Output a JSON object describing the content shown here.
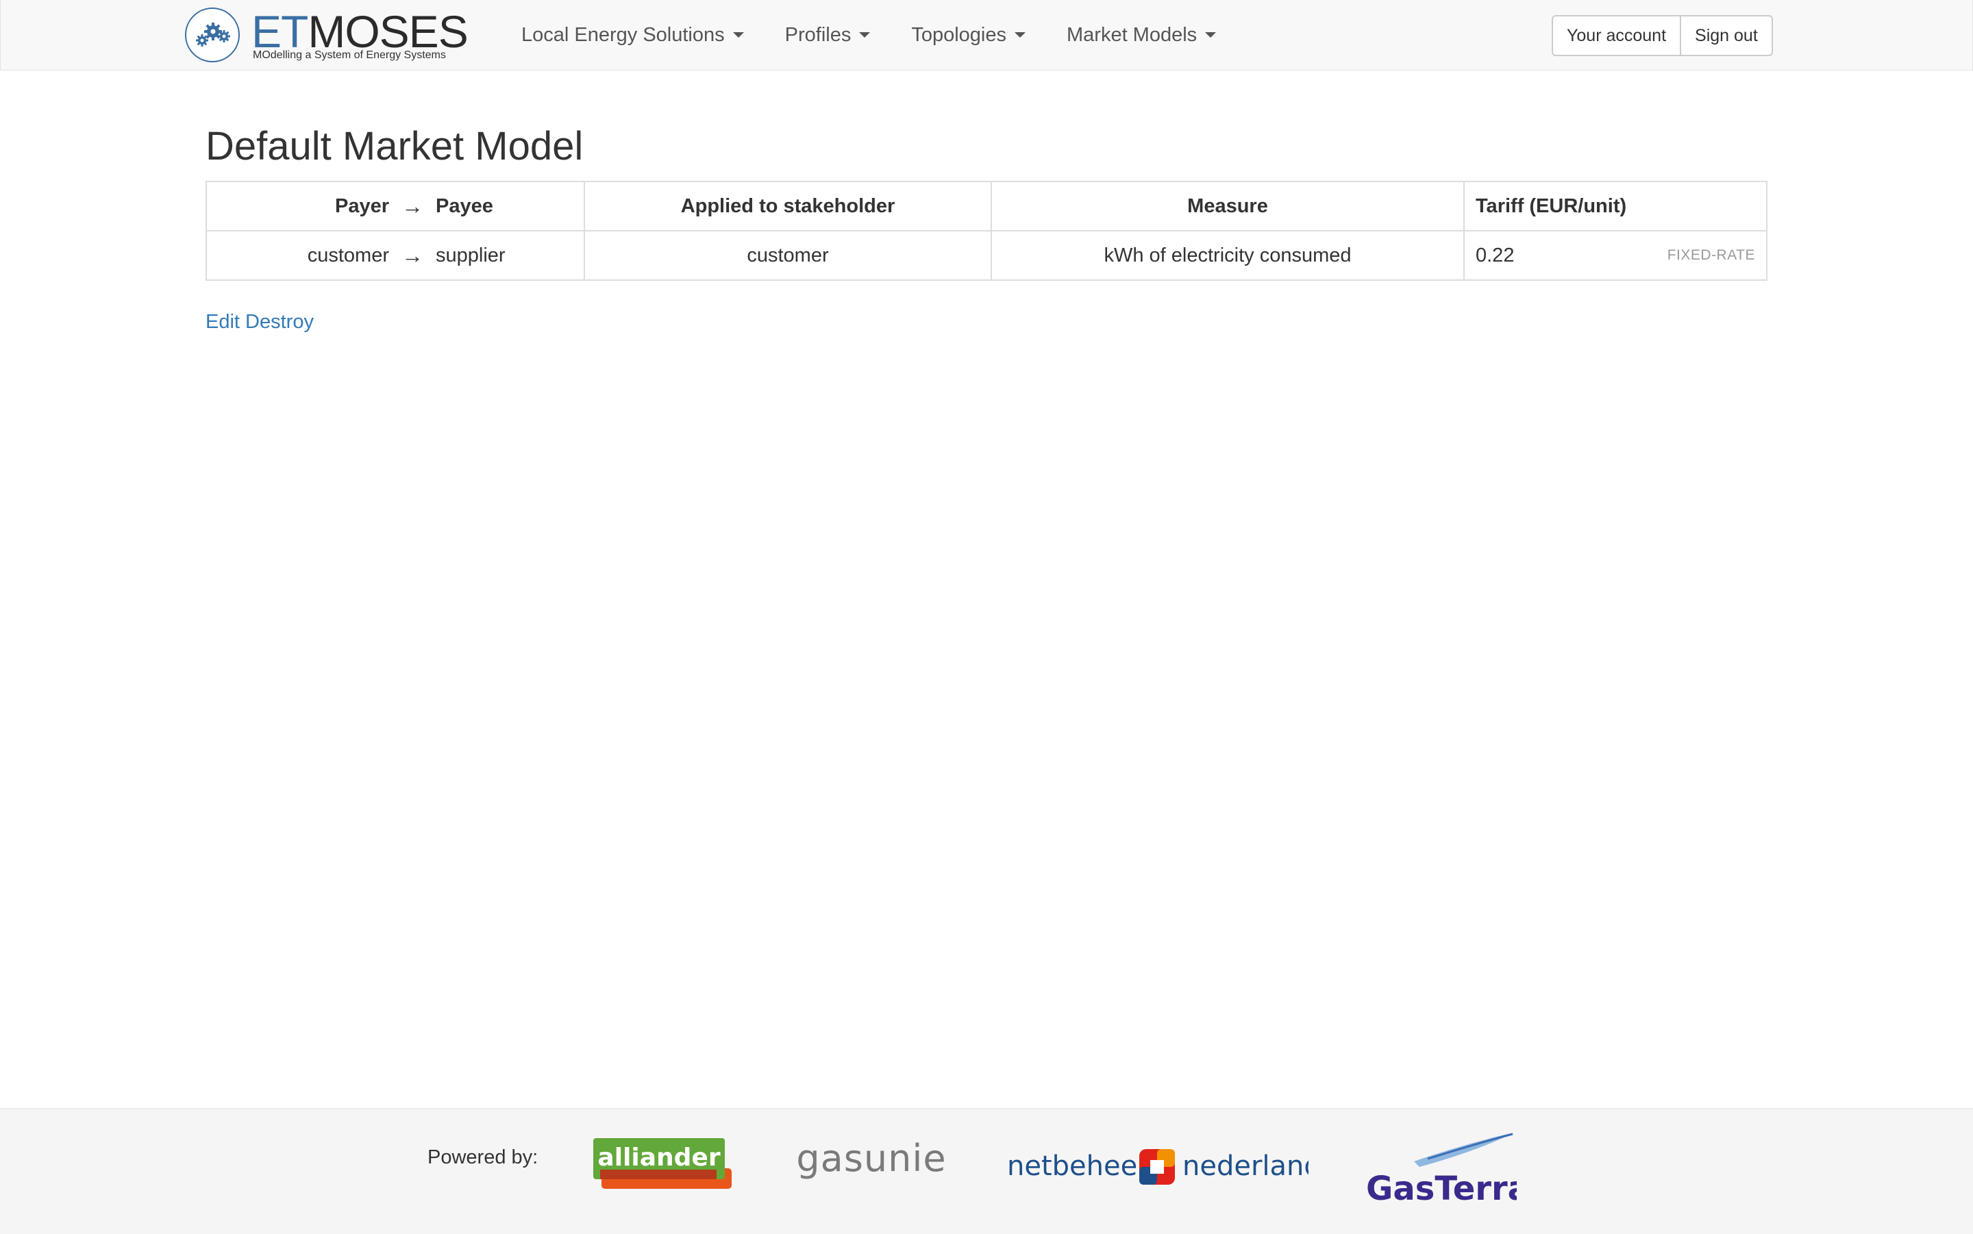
{
  "brand": {
    "name_prefix": "ET",
    "name_suffix": "MOSES",
    "subtitle": "MOdelling a System of Energy Systems",
    "accent_color": "#3a6fa3"
  },
  "nav": {
    "menus": [
      {
        "label": "Local Energy Solutions",
        "icon": "caret-down-icon"
      },
      {
        "label": "Profiles",
        "icon": "caret-down-icon"
      },
      {
        "label": "Topologies",
        "icon": "caret-down-icon"
      },
      {
        "label": "Market Models",
        "icon": "caret-down-icon"
      }
    ],
    "account_label": "Your account",
    "signout_label": "Sign out"
  },
  "page": {
    "title": "Default Market Model"
  },
  "table": {
    "headers": {
      "payer": "Payer",
      "arrow": "→",
      "payee": "Payee",
      "stakeholder": "Applied to stakeholder",
      "measure": "Measure",
      "tariff": "Tariff (EUR/unit)"
    },
    "rows": [
      {
        "payer": "customer",
        "arrow": "→",
        "payee": "supplier",
        "stakeholder": "customer",
        "measure": "kWh of electricity consumed",
        "tariff": "0.22",
        "tariff_type": "FIXED-RATE"
      }
    ]
  },
  "actions": {
    "edit_label": "Edit",
    "destroy_label": "Destroy",
    "link_color": "#337ab7"
  },
  "footer": {
    "powered_by": "Powered by:",
    "partners": {
      "alliander": "alliander",
      "gasunie": "gasunie",
      "netbeheer_left": "netbeheer",
      "netbeheer_right": "nederland",
      "gasterra": "GasTerra"
    }
  }
}
